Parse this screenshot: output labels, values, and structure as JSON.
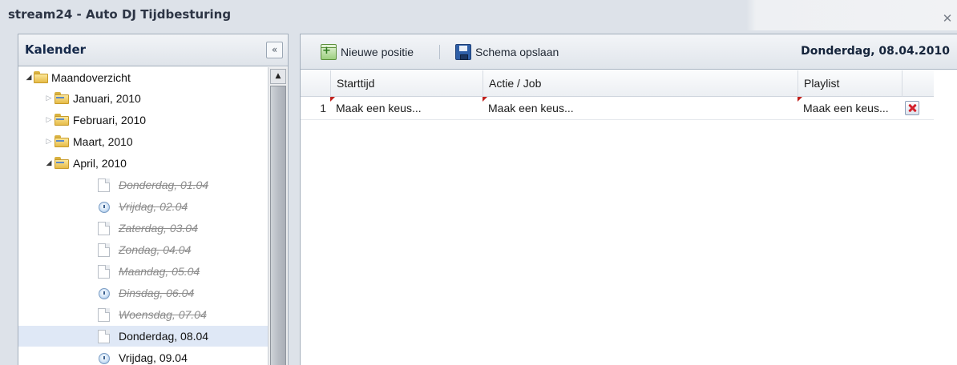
{
  "window": {
    "title": "stream24 - Auto DJ Tijdbesturing",
    "close_glyph": "✕"
  },
  "left_panel": {
    "title": "Kalender",
    "collapse_glyph": "«",
    "tree": {
      "root": "Maandoverzicht",
      "months": [
        "Januari, 2010",
        "Februari, 2010",
        "Maart, 2010",
        "April, 2010"
      ],
      "days": [
        {
          "label": "Donderdag, 01.04",
          "icon": "page-icon",
          "past": true
        },
        {
          "label": "Vrijdag, 02.04",
          "icon": "clock-icon",
          "past": true
        },
        {
          "label": "Zaterdag, 03.04",
          "icon": "page-icon",
          "past": true
        },
        {
          "label": "Zondag, 04.04",
          "icon": "page-icon",
          "past": true
        },
        {
          "label": "Maandag, 05.04",
          "icon": "page-icon",
          "past": true
        },
        {
          "label": "Dinsdag, 06.04",
          "icon": "clock-icon",
          "past": true
        },
        {
          "label": "Woensdag, 07.04",
          "icon": "page-icon",
          "past": true
        },
        {
          "label": "Donderdag, 08.04",
          "icon": "page-icon",
          "past": false,
          "selected": true
        },
        {
          "label": "Vrijdag, 09.04",
          "icon": "clock-icon",
          "past": false
        }
      ]
    }
  },
  "toolbar": {
    "new_position_label": "Nieuwe positie",
    "save_schedule_label": "Schema opslaan",
    "current_date": "Donderdag, 08.04.2010"
  },
  "grid": {
    "columns": [
      "Starttijd",
      "Actie / Job",
      "Playlist"
    ],
    "rows": [
      {
        "num": "1",
        "starttijd": "Maak een keus...",
        "actie": "Maak een keus...",
        "playlist": "Maak een keus..."
      }
    ]
  },
  "colors": {
    "selected_row": "#dfe8f6",
    "dirty_marker": "#c0211d",
    "delete_icon": "#d4232e"
  }
}
